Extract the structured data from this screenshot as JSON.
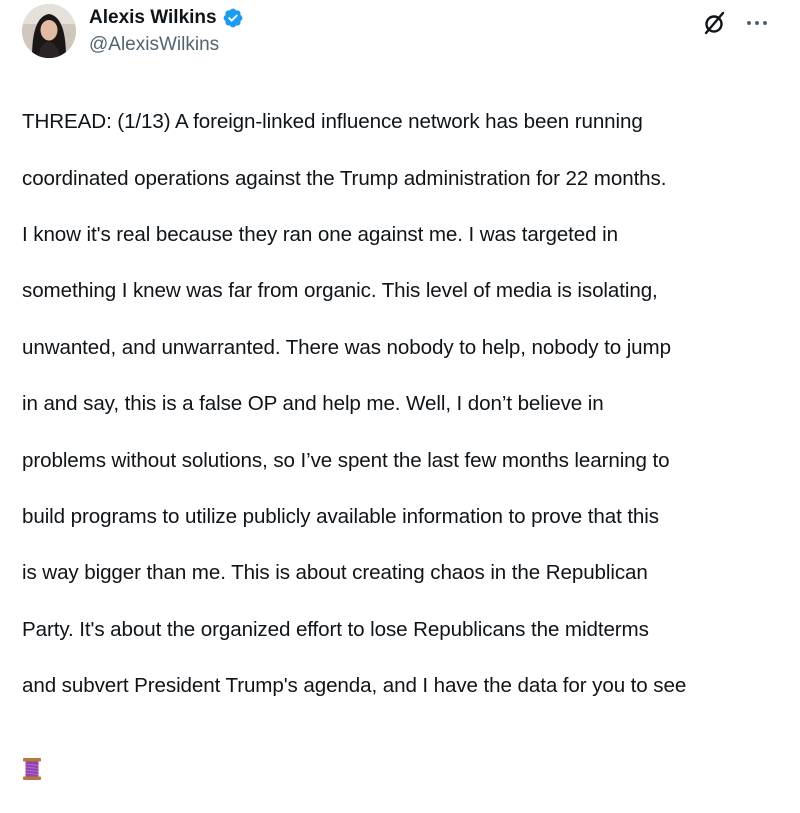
{
  "author": {
    "name": "Alexis Wilkins",
    "handle": "@AlexisWilkins",
    "verified": true,
    "verified_color": "#1d9bf0"
  },
  "icons": {
    "avatar": "profile-photo",
    "verified": "verified-badge-icon",
    "grok": "grok-icon",
    "more": "more-options-icon",
    "thread_emoji": "spool-of-thread-emoji"
  },
  "tweet": {
    "lines": [
      "THREAD: (1/13) A foreign-linked influence network has been running",
      "coordinated operations against the Trump administration for 22 months.",
      "I know it's real because they ran one against me. I was targeted in",
      "something I knew was far from organic. This level of media is isolating,",
      "unwanted, and unwarranted. There was nobody to help, nobody to jump",
      "in and say, this is a false OP and help me. Well, I don’t believe in",
      "problems without solutions, so I’ve spent the last few months learning to",
      "build programs to utilize publicly available information to prove that this",
      "is way bigger than me. This is about creating chaos in the Republican",
      "Party. It's about the organized effort to lose Republicans the midterms",
      "and subvert President Trump's agenda, and I have the data for you to see"
    ]
  },
  "colors": {
    "text": "#0f1419",
    "secondary_text": "#536471"
  }
}
